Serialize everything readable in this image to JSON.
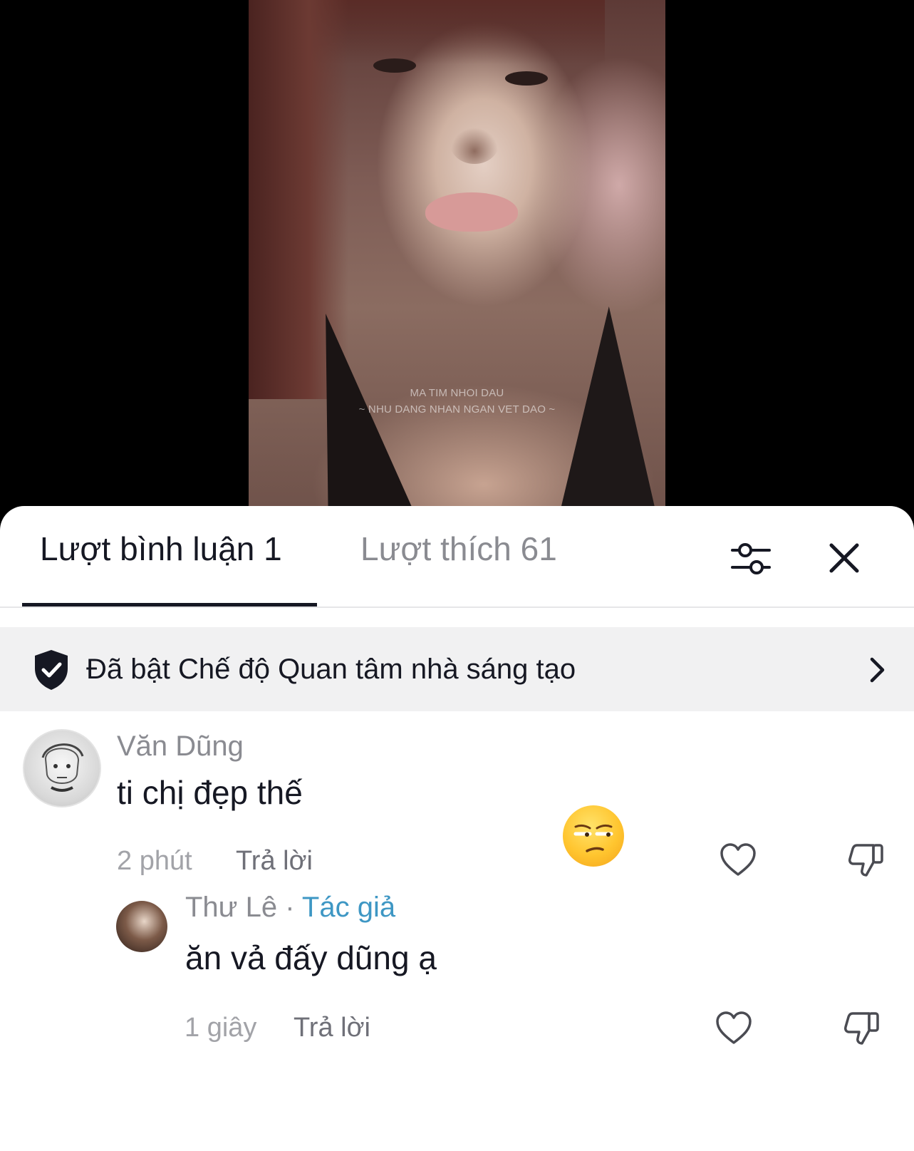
{
  "video": {
    "watermark_line1": "MA TIM NHOI DAU",
    "watermark_line2": "~ NHU DANG NHAN NGAN VET DAO ~"
  },
  "tabs": {
    "comments_label": "Lượt bình luận 1",
    "likes_label": "Lượt thích 61",
    "active": "comments"
  },
  "icons": {
    "filter": "sliders-icon",
    "close": "close-icon",
    "shield": "shield-check-icon",
    "chevron": "chevron-right-icon",
    "like": "heart-outline-icon",
    "dislike": "thumbs-down-outline-icon",
    "emoji": "unamused-face-emoji"
  },
  "banner": {
    "text": "Đã bật Chế độ Quan tâm nhà sáng tạo"
  },
  "comments": [
    {
      "username": "Văn Dũng",
      "text": "ti chị đẹp thế",
      "time": "2 phút",
      "reply_label": "Trả lời",
      "reaction_emoji": "😒"
    },
    {
      "username": "Thư Lê",
      "separator": "·",
      "badge": "Tác giả",
      "text": "ăn vả đấy dũng ạ",
      "time": "1 giây",
      "reply_label": "Trả lời"
    }
  ],
  "colors": {
    "author_badge": "#3e97c4",
    "text_primary": "#161823",
    "text_secondary": "#8a8b91",
    "banner_bg": "#f1f1f2"
  }
}
